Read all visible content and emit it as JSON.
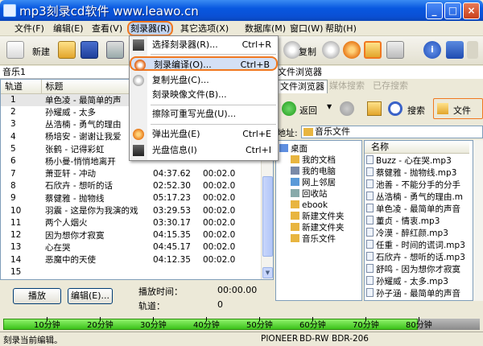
{
  "window": {
    "title": "mp3刻录cd软件 www.leawo.cn"
  },
  "menubar": {
    "items": [
      "文件(F)",
      "编辑(E)",
      "查看(V)",
      "刻录器(R)",
      "其它选项(X)",
      "数据库(M)",
      "窗口(W)",
      "帮助(H)"
    ]
  },
  "toolbar": {
    "new_label": "新建",
    "copy_label": "复制"
  },
  "left_panel": {
    "title": "音乐1"
  },
  "tracklist": {
    "columns": [
      "轨道",
      "标题",
      "",
      "",
      ""
    ],
    "rows": [
      {
        "num": "1",
        "title": "单色凌 - 最简单的声",
        "d1": "",
        "d2": ""
      },
      {
        "num": "2",
        "title": "孙耀威 - 太多",
        "d1": "",
        "d2": ""
      },
      {
        "num": "3",
        "title": "丛浩楠 - 勇气的理由",
        "d1": "",
        "d2": ""
      },
      {
        "num": "4",
        "title": "杨培安 - 谢谢让我爱",
        "d1": "",
        "d2": ""
      },
      {
        "num": "5",
        "title": "张鹤 - 记得彩虹",
        "d1": "",
        "d2": ""
      },
      {
        "num": "6",
        "title": "杨小曼-悄悄地离开",
        "d1": "",
        "d2": ""
      },
      {
        "num": "7",
        "title": "萧亚轩 - 冲动",
        "d1": "04:37.62",
        "d2": "00:02.0"
      },
      {
        "num": "8",
        "title": "石欣卉 - 想听的话",
        "d1": "02:52.30",
        "d2": "00:02.0"
      },
      {
        "num": "9",
        "title": "蔡健雅 - 抛物线",
        "d1": "05:17.23",
        "d2": "00:02.0"
      },
      {
        "num": "10",
        "title": "羽震 - 这是你为我演的戏",
        "d1": "03:29.53",
        "d2": "00:02.0"
      },
      {
        "num": "11",
        "title": "两个人烟火",
        "d1": "03:30.17",
        "d2": "00:02.0"
      },
      {
        "num": "12",
        "title": "因为想你才寂寞",
        "d1": "04:15.35",
        "d2": "00:02.0"
      },
      {
        "num": "13",
        "title": "心在哭",
        "d1": "04:45.17",
        "d2": "00:02.0"
      },
      {
        "num": "14",
        "title": "恶魔中的天使",
        "d1": "04:12.35",
        "d2": "00:02.0"
      },
      {
        "num": "15",
        "title": "",
        "d1": "",
        "d2": ""
      }
    ]
  },
  "player": {
    "play_label": "播放",
    "edit_label": "编辑(E)...",
    "time_label": "播放时间：",
    "time_value": "00:00.00",
    "track_label": "轨道：",
    "track_value": "0"
  },
  "right_panel": {
    "title": "文件浏览器",
    "tabs": [
      "文件浏览器",
      "媒体搜索",
      "已存搜索"
    ],
    "back_label": "返回",
    "search_label": "搜索",
    "files_label": "文件",
    "address_label": "地址:",
    "address_value": "音乐文件",
    "tree": [
      "桌面",
      "我的文档",
      "我的电脑",
      "网上邻居",
      "回收站",
      "ebook",
      "新建文件夹",
      "新建文件夹",
      "音乐文件"
    ],
    "files_header": "名称",
    "files": [
      "Buzz - 心在哭.mp3",
      "蔡健雅 - 抛物线.mp3",
      "池善 - 不能分手的分手",
      "丛浩楠 - 勇气的理由.m",
      "单色凌 - 最简单的声音",
      "董贞 - 情衷.mp3",
      "冷漠 - 醉红颜.mp3",
      "任重 - 时间的谎词.mp3",
      "石欣卉 - 想听的话.mp3",
      "舒鸣 - 因为想你才寂寞",
      "孙耀威 - 太多.mp3",
      "孙子涵 - 最简单的声音"
    ]
  },
  "dropdown": {
    "items": [
      {
        "label": "选择刻录器(R)...",
        "shortcut": "Ctrl+R"
      },
      {
        "label": "刻录编译(O)...",
        "shortcut": "Ctrl+B"
      },
      {
        "label": "复制光盘(C)...",
        "shortcut": ""
      },
      {
        "label": "刻录映像文件(B)...",
        "shortcut": ""
      },
      {
        "label": "擦除可重写光盘(U)...",
        "shortcut": ""
      },
      {
        "label": "弹出光盘(E)",
        "shortcut": "Ctrl+E"
      },
      {
        "label": "光盘信息(I)",
        "shortcut": "Ctrl+I"
      }
    ]
  },
  "capacity": {
    "ticks": [
      "10分钟",
      "20分钟",
      "30分钟",
      "40分钟",
      "50分钟",
      "60分钟",
      "70分钟",
      "80分钟"
    ],
    "used_fraction": 0.87
  },
  "statusbar": {
    "message": "刻录当前编辑。",
    "drive_vendor": "PIONEER",
    "drive_type": "BD-RW",
    "drive_model": "BDR-206"
  },
  "colors": {
    "accent": "#0a4fd3",
    "highlight": "#f07820",
    "capacity": "#3bc21a"
  }
}
